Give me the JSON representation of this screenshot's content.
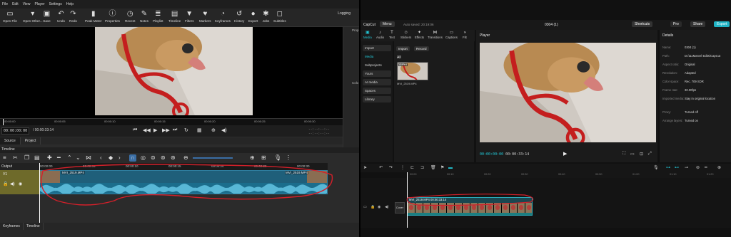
{
  "shotcut": {
    "menu": [
      "File",
      "Edit",
      "View",
      "Player",
      "Settings",
      "Help"
    ],
    "toolbar": [
      {
        "label": "Open File",
        "icon": "folder-icon",
        "glyph": "▭"
      },
      {
        "label": "Open Other...",
        "icon": "open-other-icon",
        "glyph": "▾"
      },
      {
        "label": "Save",
        "icon": "save-icon",
        "glyph": "▣"
      },
      {
        "label": "Undo",
        "icon": "undo-icon",
        "glyph": "↶"
      },
      {
        "label": "Redo",
        "icon": "redo-icon",
        "glyph": "↷"
      },
      {
        "label": "Peak Meter",
        "icon": "peak-meter-icon",
        "glyph": "▮"
      },
      {
        "label": "Properties",
        "icon": "properties-icon",
        "glyph": "ⓘ"
      },
      {
        "label": "Recent",
        "icon": "recent-icon",
        "glyph": "◷"
      },
      {
        "label": "Notes",
        "icon": "notes-icon",
        "glyph": "✎"
      },
      {
        "label": "Playlist",
        "icon": "playlist-icon",
        "glyph": "≣"
      },
      {
        "label": "Timeline",
        "icon": "timeline-icon",
        "glyph": "▤"
      },
      {
        "label": "Filters",
        "icon": "filters-icon",
        "glyph": "▼"
      },
      {
        "label": "Markers",
        "icon": "markers-icon",
        "glyph": "♥"
      },
      {
        "label": "Keyframes",
        "icon": "keyframes-icon",
        "glyph": "◔"
      },
      {
        "label": "History",
        "icon": "history-icon",
        "glyph": "↺"
      },
      {
        "label": "Export",
        "icon": "export-icon",
        "glyph": "●"
      },
      {
        "label": "Jobs",
        "icon": "jobs-icon",
        "glyph": "✱"
      },
      {
        "label": "Subtitles",
        "icon": "subtitles-icon",
        "glyph": "◻"
      }
    ],
    "logging": "Logging",
    "side_labels": [
      "Prop",
      "Colo"
    ],
    "ruler_ticks": [
      "00:00:00",
      "00:00:05",
      "00:00:10",
      "00:00:15",
      "00:00:20",
      "00:00:25",
      "00:00:30"
    ],
    "timecode_current": "00:00:00:00",
    "timecode_total": "/ 00:00:33:14",
    "timecode_right1": "--:--:--:--",
    "timecode_right2": "--:--:--:--",
    "tabs": [
      "Source",
      "Project"
    ],
    "timeline_header": "Timeline",
    "output_label": "Output",
    "track_name": "V1",
    "timeline_ruler": [
      "00:00:00",
      "00:00:05",
      "00:00:10",
      "00:00:15",
      "00:00:20",
      "00:00:25",
      "00:00:30"
    ],
    "clip_name_start": "MVI_2519.MP4",
    "clip_name_end": "MVI_2519.MP4",
    "bottom_tabs": [
      "Keyframes",
      "Timeline"
    ]
  },
  "capcut": {
    "logo": "CapCut",
    "menu": "Menu",
    "autosave": "Auto saved: 20:19:06",
    "project_name": "0304 (1)",
    "shortcuts": "Shortcuts",
    "pro": "Pro",
    "share": "Share",
    "export": "Export",
    "tools": [
      {
        "label": "Media",
        "icon": "media-icon",
        "glyph": "▣",
        "active": true
      },
      {
        "label": "Audio",
        "icon": "audio-icon",
        "glyph": "♪",
        "active": false
      },
      {
        "label": "Text",
        "icon": "text-icon",
        "glyph": "T",
        "active": false
      },
      {
        "label": "Stickers",
        "icon": "stickers-icon",
        "glyph": "☺",
        "active": false
      },
      {
        "label": "Effects",
        "icon": "effects-icon",
        "glyph": "✦",
        "active": false
      },
      {
        "label": "Transitions",
        "icon": "transitions-icon",
        "glyph": "⋈",
        "active": false
      },
      {
        "label": "Captions",
        "icon": "captions-icon",
        "glyph": "▭",
        "active": false
      },
      {
        "label": "Filt",
        "icon": "filters-icon",
        "glyph": "◑",
        "active": false
      }
    ],
    "nav": [
      "Import",
      "Media",
      "Subprojects",
      "Yours",
      "AI media",
      "Spaces",
      "Library"
    ],
    "import_btn": "Import",
    "record_btn": "Record",
    "all_label": "All",
    "thumb_badge": "Added",
    "thumb_name": "MVI_2519.MP4",
    "player_title": "Player",
    "player_tc_current": "00:00:00:00",
    "player_tc_total": "00:00:33:14",
    "details_title": "Details",
    "details": [
      {
        "k": "Name:",
        "v": "0304 (1)"
      },
      {
        "k": "Path:",
        "v": "D:/111Marvel Edits/CapCut"
      },
      {
        "k": "Aspect ratio:",
        "v": "Original"
      },
      {
        "k": "Resolution:",
        "v": "Adapted"
      },
      {
        "k": "Color space:",
        "v": "Rec. 709 SDR"
      },
      {
        "k": "Frame rate:",
        "v": "30.00fps"
      },
      {
        "k": "Imported media:",
        "v": "Stay in original location"
      },
      {
        "k": "Proxy:",
        "v": "Turned off"
      },
      {
        "k": "Arrange layers:",
        "v": "Turned on"
      }
    ],
    "ruler_ticks": [
      "00:00",
      "00:10",
      "00:20",
      "00:30",
      "00:40",
      "00:50",
      "01:00",
      "01:10",
      "01:20",
      "01:30"
    ],
    "clip_label": "MVI_2519.MP4  00:00:33:14",
    "cover": "Cover"
  },
  "colors": {
    "capcut_accent": "#22c7d6",
    "annotation_red": "#d4202a",
    "shotcut_track": "#6e6a2a"
  }
}
